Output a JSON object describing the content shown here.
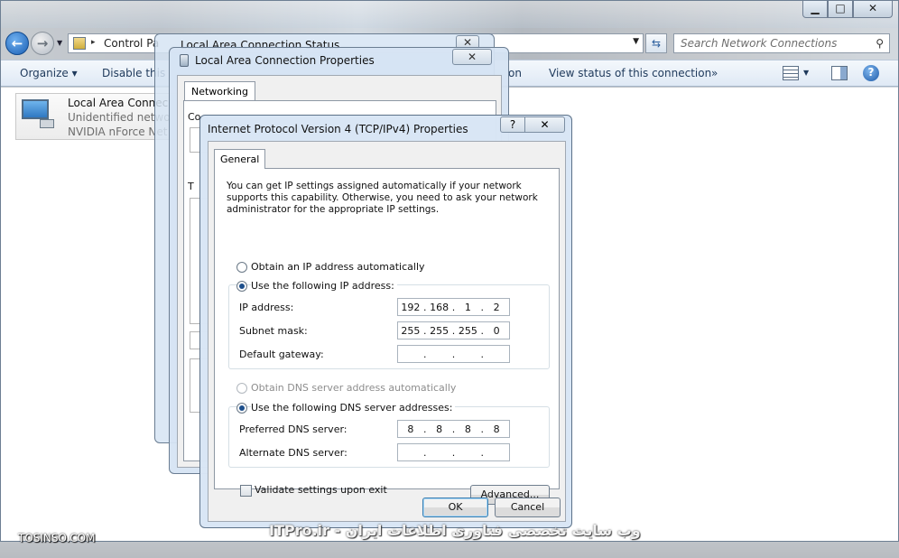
{
  "explorer": {
    "caption": {
      "minimize": "▁",
      "maximize": "□",
      "close": "✕"
    },
    "address": {
      "path": "Control Pa",
      "separator": "▸"
    },
    "search": {
      "placeholder": "Search Network Connections"
    },
    "toolbar": {
      "organize": "Organize ▾",
      "disable": "Disable this",
      "status_tail": "on",
      "view_status": "View status of this connection",
      "more": "»",
      "help": "?"
    },
    "connection": {
      "name": "Local Area Connec",
      "status": "Unidentified netwo",
      "adapter": "NVIDIA nForce Net"
    }
  },
  "status_window": {
    "title": "Local Area Connection Status",
    "close": "✕"
  },
  "properties_window": {
    "title": "Local Area Connection Properties",
    "close": "✕",
    "tab": "Networking",
    "snippet1": "Co",
    "snippet2": "T"
  },
  "ipv4_dialog": {
    "title": "Internet Protocol Version 4 (TCP/IPv4) Properties",
    "help": "?",
    "close": "✕",
    "tab": "General",
    "intro": "You can get IP settings assigned automatically if your network supports this capability. Otherwise, you need to ask your network administrator for the appropriate IP settings.",
    "ip_auto_label": "Obtain an IP address automatically",
    "ip_manual_label": "Use the following IP address:",
    "ip_mode": "manual",
    "ip_address_label": "IP address:",
    "ip_address": [
      "192",
      "168",
      "1",
      "2"
    ],
    "subnet_label": "Subnet mask:",
    "subnet": [
      "255",
      "255",
      "255",
      "0"
    ],
    "gateway_label": "Default gateway:",
    "gateway": [
      "",
      "",
      "",
      ""
    ],
    "dns_auto_label": "Obtain DNS server address automatically",
    "dns_manual_label": "Use the following DNS server addresses:",
    "dns_mode": "manual",
    "preferred_dns_label": "Preferred DNS server:",
    "preferred_dns": [
      "8",
      "8",
      "8",
      "8"
    ],
    "alternate_dns_label": "Alternate DNS server:",
    "alternate_dns": [
      "",
      "",
      "",
      ""
    ],
    "validate_label": "Validate settings upon exit",
    "validate_checked": false,
    "advanced": "Advanced...",
    "ok": "OK",
    "cancel": "Cancel"
  },
  "watermarks": {
    "left": "TOSINSO.COM",
    "right": "ITPro.ir - وب سایت تخصصی فناوری اطلاعات ایران"
  }
}
